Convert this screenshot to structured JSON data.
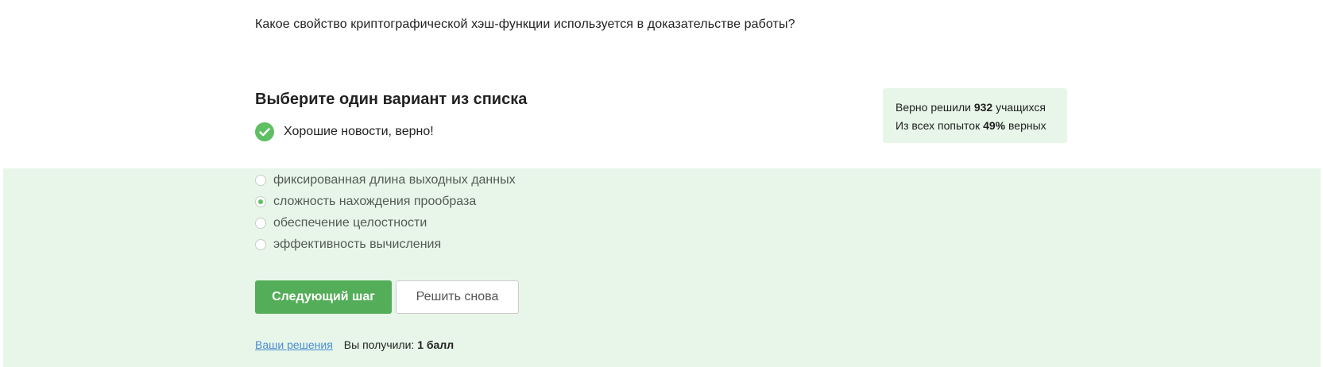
{
  "question": {
    "text": "Какое свойство криптографической хэш-функции используется в доказательстве работы?"
  },
  "quiz": {
    "title": "Выберите один вариант из списка",
    "feedback": "Хорошие новости, верно!"
  },
  "stats": {
    "solved_prefix": "Верно решили ",
    "solved_count": "932",
    "solved_suffix": " учащихся",
    "attempts_prefix": "Из всех попыток ",
    "attempts_percent": "49%",
    "attempts_suffix": " верных"
  },
  "options": [
    {
      "label": "фиксированная длина выходных данных",
      "selected": false
    },
    {
      "label": "сложность нахождения прообраза",
      "selected": true
    },
    {
      "label": "обеспечение целостности",
      "selected": false
    },
    {
      "label": "эффективность вычисления",
      "selected": false
    }
  ],
  "buttons": {
    "next_label": "Следующий шаг",
    "retry_label": "Решить снова"
  },
  "footer": {
    "solutions_link": "Ваши решения",
    "score_prefix": "Вы получили: ",
    "score_value": "1 балл"
  },
  "colors": {
    "accent_green": "#54ad58",
    "panel_green": "#e7f6e8",
    "link_blue": "#4a8bd4"
  },
  "icons": {
    "feedback": "check-circle-icon"
  }
}
